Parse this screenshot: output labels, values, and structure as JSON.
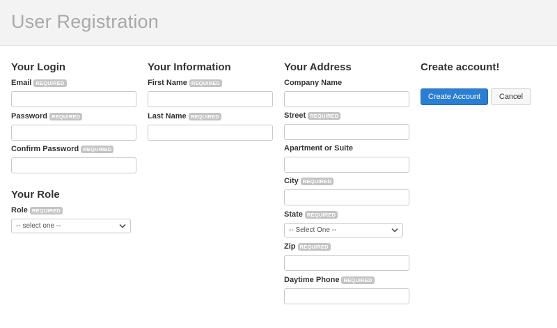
{
  "header": {
    "title": "User Registration"
  },
  "required_badge": "REQUIRED",
  "login": {
    "heading": "Your Login",
    "email_label": "Email",
    "password_label": "Password",
    "confirm_password_label": "Confirm Password"
  },
  "role": {
    "heading": "Your Role",
    "role_label": "Role",
    "role_selected": "-- select one --"
  },
  "information": {
    "heading": "Your Information",
    "first_name_label": "First Name",
    "last_name_label": "Last Name"
  },
  "address": {
    "heading": "Your Address",
    "company_label": "Company Name",
    "street_label": "Street",
    "apartment_label": "Apartment or Suite",
    "city_label": "City",
    "state_label": "State",
    "state_selected": "-- Select One --",
    "zip_label": "Zip",
    "phone_label": "Daytime Phone"
  },
  "create": {
    "heading": "Create account!",
    "create_button": "Create Account",
    "cancel_button": "Cancel"
  },
  "colors": {
    "primary_button": "#2a7ed3",
    "required_badge": "#c4c4c4",
    "header_background": "#f3f3f3",
    "title_text": "#a9a9a9"
  }
}
